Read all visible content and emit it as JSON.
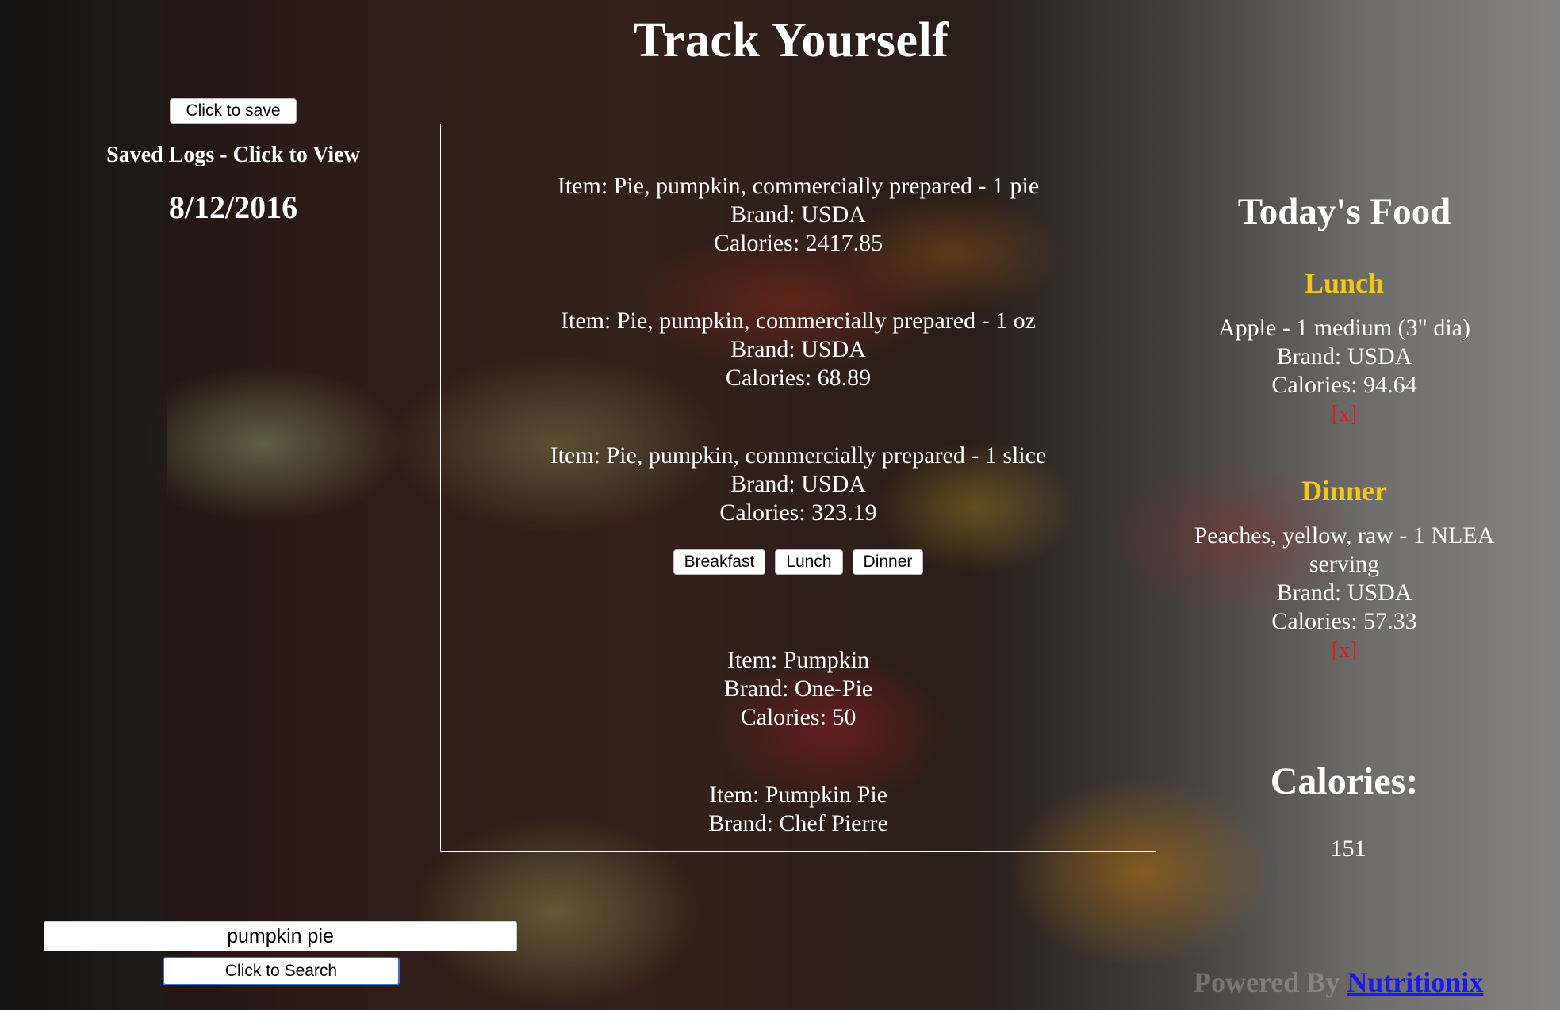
{
  "header": {
    "title": "Track Yourself"
  },
  "left": {
    "save_label": "Click to save",
    "saved_logs_heading": "Saved Logs - Click to View",
    "saved_logs": [
      "8/12/2016"
    ]
  },
  "results": [
    {
      "item": "Item: Pie, pumpkin, commercially prepared - 1 pie",
      "brand": "Brand: USDA",
      "calories": "Calories: 2417.85"
    },
    {
      "item": "Item: Pie, pumpkin, commercially prepared - 1 oz",
      "brand": "Brand: USDA",
      "calories": "Calories: 68.89"
    },
    {
      "item": "Item: Pie, pumpkin, commercially prepared - 1 slice",
      "brand": "Brand: USDA",
      "calories": "Calories: 323.19"
    },
    {
      "item": "Item: Pumpkin",
      "brand": "Brand: One-Pie",
      "calories": "Calories: 50"
    },
    {
      "item": "Item: Pumpkin Pie",
      "brand": "Brand: Chef Pierre",
      "calories": ""
    }
  ],
  "meal_buttons": {
    "breakfast": "Breakfast",
    "lunch": "Lunch",
    "dinner": "Dinner"
  },
  "today": {
    "heading": "Today's Food",
    "remove_label": "[x]",
    "lunch": {
      "title": "Lunch",
      "entries": [
        {
          "item": "Apple - 1 medium (3\" dia)",
          "brand": "Brand: USDA",
          "calories": "Calories: 94.64"
        }
      ]
    },
    "dinner": {
      "title": "Dinner",
      "entries": [
        {
          "item": "Peaches, yellow, raw - 1 NLEA serving",
          "brand": "Brand: USDA",
          "calories": "Calories: 57.33"
        }
      ]
    },
    "calories_heading": "Calories:",
    "calories_total": "151"
  },
  "search": {
    "value": "pumpkin pie",
    "button_label": "Click to Search"
  },
  "footer": {
    "powered_text": "Powered By",
    "link_text": "Nutritionix"
  },
  "colors": {
    "meal_title": "#f5c518",
    "remove": "#e01b1b",
    "link": "#1a1aee"
  }
}
